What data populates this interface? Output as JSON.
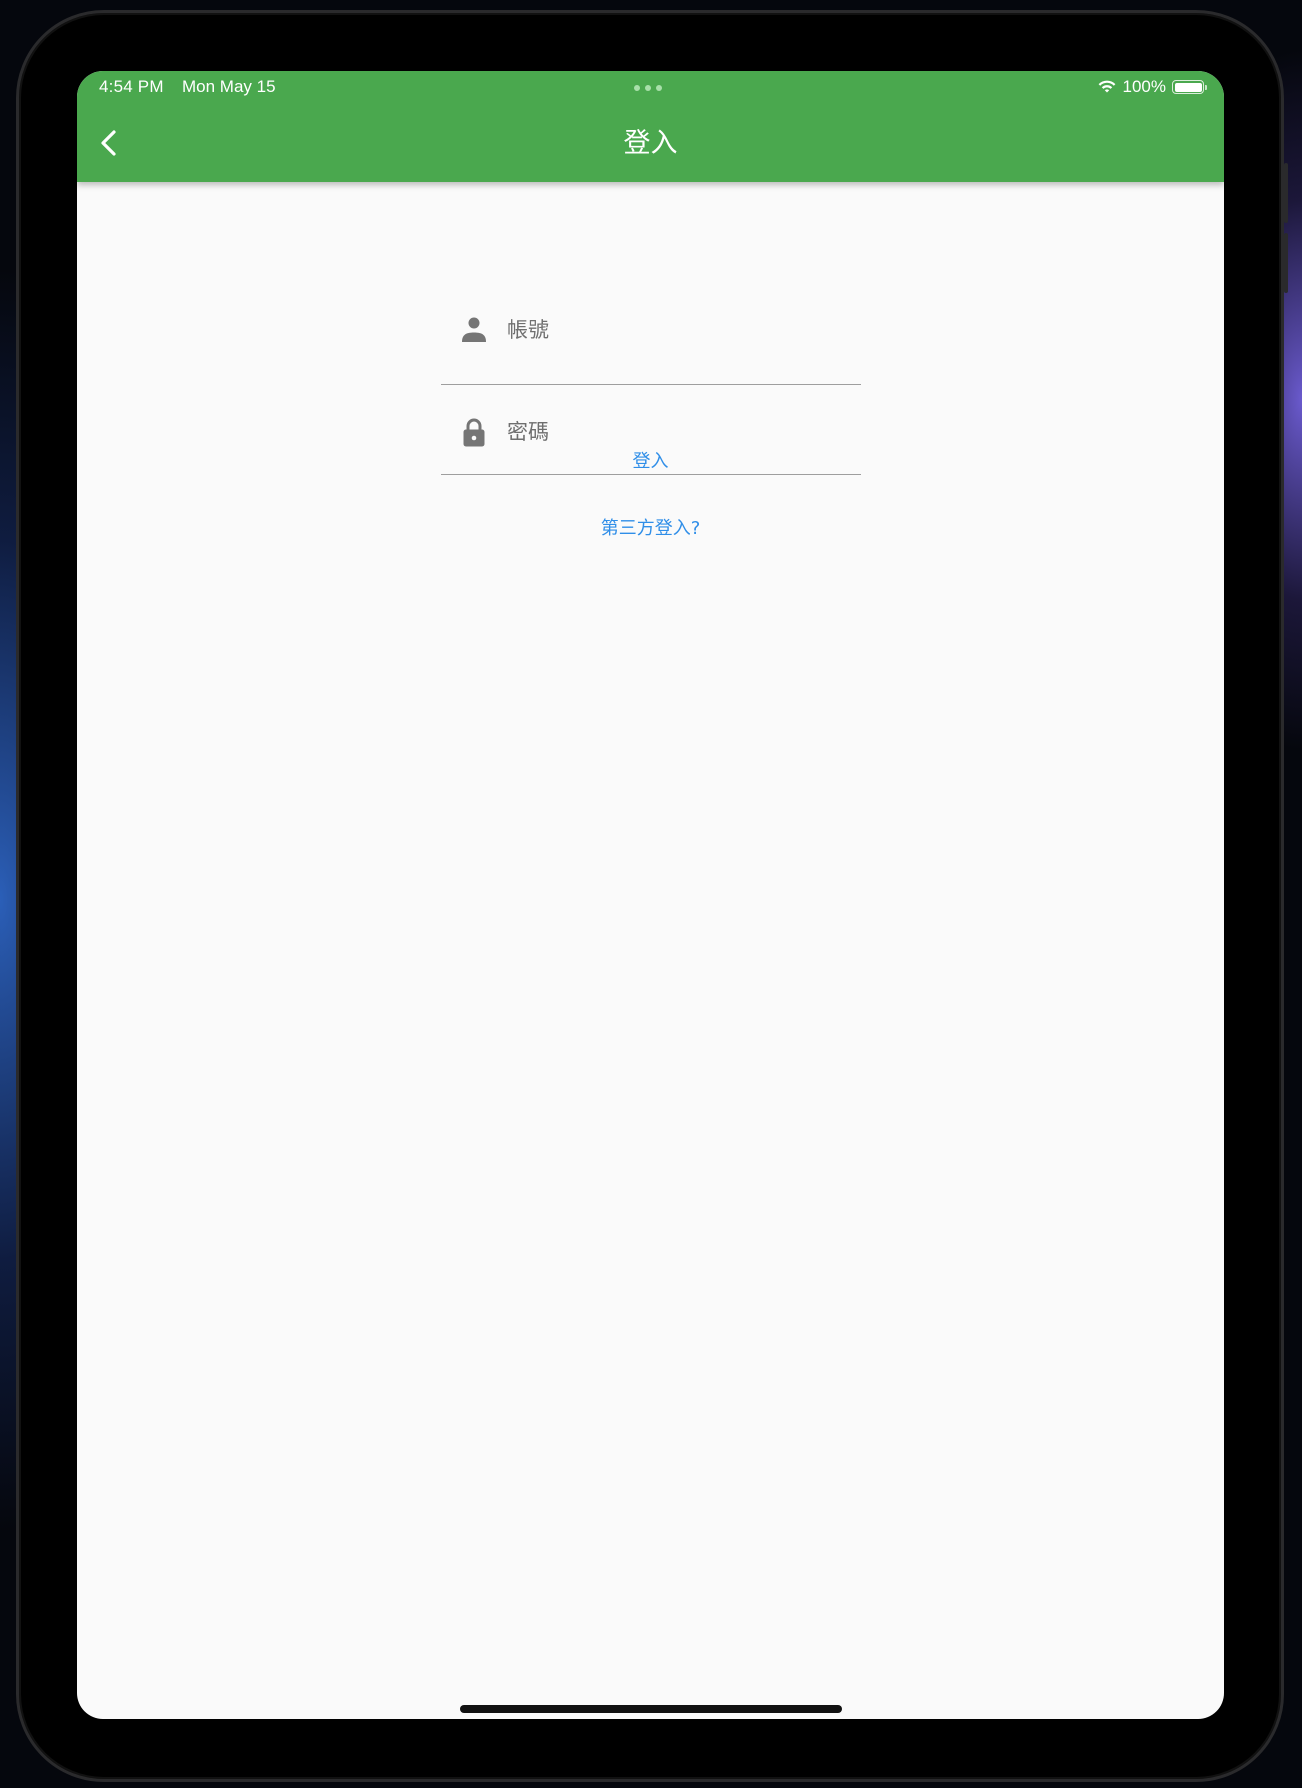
{
  "status_bar": {
    "time": "4:54 PM",
    "date": "Mon May 15",
    "battery": "100%"
  },
  "app_bar": {
    "title": "登入",
    "background_color": "#4aa84e"
  },
  "form": {
    "username": {
      "placeholder": "帳號",
      "value": "",
      "icon": "person-icon"
    },
    "password": {
      "placeholder": "密碼",
      "value": "",
      "icon": "lock-icon"
    }
  },
  "actions": {
    "login_label": "登入",
    "third_party_label": "第三方登入?",
    "link_color": "#2f8ee8"
  }
}
